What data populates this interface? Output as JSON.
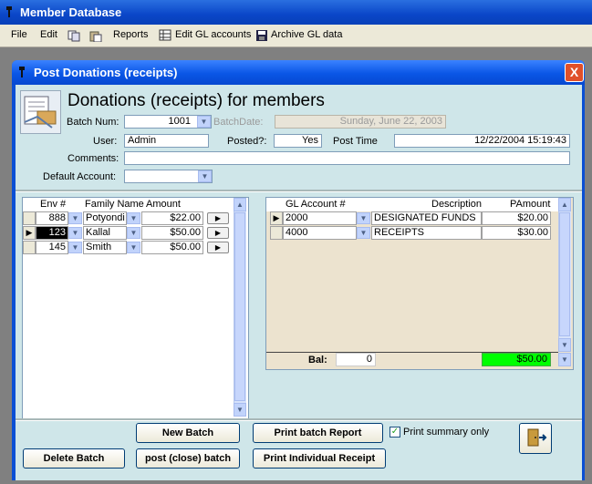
{
  "app": {
    "title": "Member Database",
    "menu": [
      {
        "label": "File"
      },
      {
        "label": "Edit"
      },
      {
        "label": "Reports"
      },
      {
        "label": "Edit GL accounts"
      },
      {
        "label": "Archive GL data"
      }
    ]
  },
  "window": {
    "title": "Post Donations (receipts)",
    "heading": "Donations (receipts) for members",
    "close_label": "X"
  },
  "form": {
    "batch_num_label": "Batch Num:",
    "batch_num": "1001",
    "batch_date_label": "BatchDate:",
    "batch_date": "Sunday, June 22, 2003",
    "user_label": "User:",
    "user": "Admin",
    "posted_label": "Posted?:",
    "posted": "Yes",
    "post_time_label": "Post Time",
    "post_time": "12/22/2004 15:19:43",
    "comments_label": "Comments:",
    "comments": "",
    "default_account_label": "Default Account:",
    "default_account": ""
  },
  "donations": {
    "columns": [
      "Env #",
      "Family Name",
      "Amount"
    ],
    "rows": [
      {
        "env": "888",
        "family": "Potyondi",
        "amount": "$22.00",
        "current": false
      },
      {
        "env": "123",
        "family": "Kallal",
        "amount": "$50.00",
        "current": true
      },
      {
        "env": "145",
        "family": "Smith",
        "amount": "$50.00",
        "current": false
      }
    ]
  },
  "gl": {
    "columns": [
      "GL Account #",
      "Description",
      "PAmount"
    ],
    "rows": [
      {
        "account": "2000",
        "description": "DESIGNATED FUNDS",
        "amount": "$20.00",
        "current": true
      },
      {
        "account": "4000",
        "description": "RECEIPTS",
        "amount": "$30.00",
        "current": false
      }
    ],
    "bal_label": "Bal:",
    "bal_value": "0",
    "total": "$50.00",
    "total_color": "#00ff00"
  },
  "buttons": {
    "new_batch": "New Batch",
    "print_batch_report": "Print batch Report",
    "print_summary_only": "Print summary only",
    "print_summary_checked": true,
    "delete_batch": "Delete Batch",
    "post_batch": "post (close) batch",
    "print_individual": "Print Individual Receipt",
    "exit_icon": "exit-door-icon"
  }
}
